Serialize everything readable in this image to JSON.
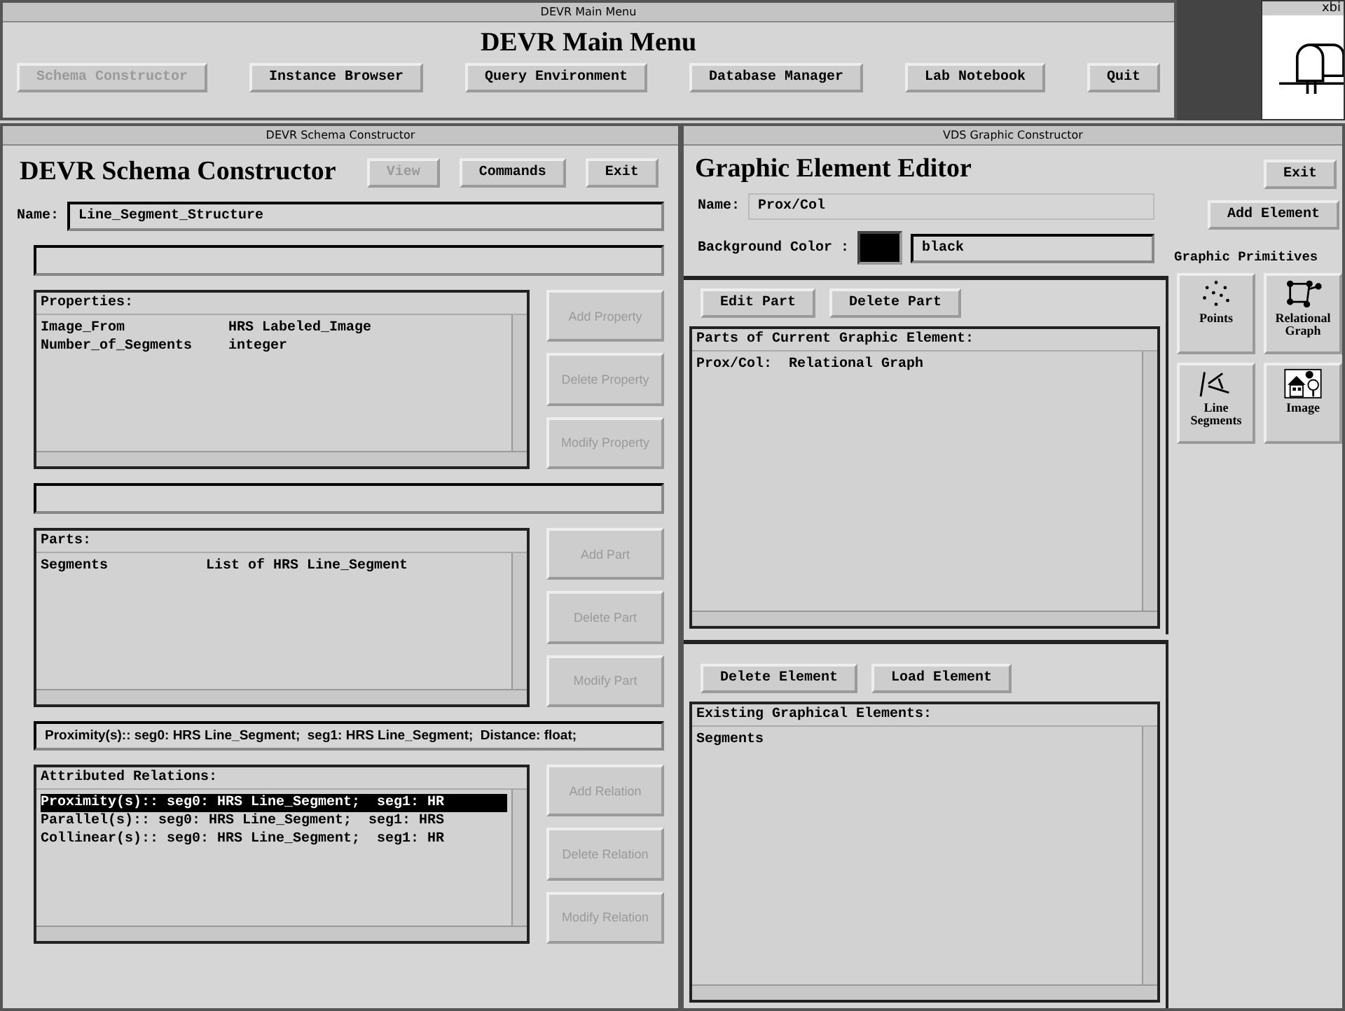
{
  "main_menu": {
    "title": "DEVR Main Menu",
    "heading": "DEVR Main Menu",
    "buttons": [
      {
        "label": "Schema Constructor",
        "disabled": true
      },
      {
        "label": "Instance Browser",
        "disabled": false
      },
      {
        "label": "Query Environment",
        "disabled": false
      },
      {
        "label": "Database Manager",
        "disabled": false
      },
      {
        "label": "Lab Notebook",
        "disabled": false
      },
      {
        "label": "Quit",
        "disabled": false
      }
    ]
  },
  "mailbox": {
    "title": "xbi"
  },
  "schema_constructor": {
    "title": "DEVR Schema Constructor",
    "heading": "DEVR Schema Constructor",
    "buttons": [
      {
        "label": "View",
        "disabled": true
      },
      {
        "label": "Commands",
        "disabled": false
      },
      {
        "label": "Exit",
        "disabled": false
      }
    ],
    "name_label": "Name:",
    "name_value": "Line_Segment_Structure",
    "properties": {
      "heading": "Properties:",
      "rows": [
        [
          "Image_From",
          "HRS Labeled_Image"
        ],
        [
          "Number_of_Segments",
          "integer"
        ]
      ],
      "buttons": [
        {
          "label": "Add Property",
          "disabled": true
        },
        {
          "label": "Delete Property",
          "disabled": true
        },
        {
          "label": "Modify Property",
          "disabled": true
        }
      ]
    },
    "parts": {
      "heading": "Parts:",
      "rows": [
        [
          "Segments",
          "List of HRS Line_Segment"
        ]
      ],
      "buttons": [
        {
          "label": "Add Part",
          "disabled": true
        },
        {
          "label": "Delete Part",
          "disabled": true
        },
        {
          "label": "Modify Part",
          "disabled": true
        }
      ]
    },
    "relation_definition": "Proximity(s):: seg0: HRS Line_Segment;  seg1: HRS Line_Segment;  Distance: float;",
    "relations": {
      "heading": "Attributed Relations:",
      "rows": [
        {
          "text": "Proximity(s):: seg0: HRS Line_Segment;  seg1: HR",
          "selected": true
        },
        {
          "text": "Parallel(s):: seg0: HRS Line_Segment;  seg1: HRS",
          "selected": false
        },
        {
          "text": "Collinear(s):: seg0: HRS Line_Segment;  seg1: HR",
          "selected": false
        }
      ],
      "buttons": [
        {
          "label": "Add Relation",
          "disabled": true
        },
        {
          "label": "Delete Relation",
          "disabled": true
        },
        {
          "label": "Modify Relation",
          "disabled": true
        }
      ]
    }
  },
  "graphic_constructor": {
    "title": "VDS Graphic Constructor",
    "heading": "Graphic Element Editor",
    "exit_button": "Exit",
    "add_button": "Add Element",
    "name_label": "Name:",
    "name_value": "Prox/Col",
    "color_label": "Background Color :",
    "color": "#000000",
    "color_value": "black",
    "part_buttons": [
      "Edit Part",
      "Delete Part"
    ],
    "parts": {
      "heading": "Parts of Current Graphic Element:",
      "rows": [
        "Prox/Col:  Relational Graph"
      ]
    },
    "element_buttons": [
      "Delete Element",
      "Load Element"
    ],
    "elements": {
      "heading": "Existing Graphical Elements:",
      "rows": [
        "Segments"
      ]
    },
    "primitives": {
      "heading": "Graphic Primitives",
      "items": [
        {
          "kind": "points",
          "label": "Points"
        },
        {
          "kind": "graph",
          "label": "Relational Graph"
        },
        {
          "kind": "lines",
          "label": "Line Segments"
        },
        {
          "kind": "image",
          "label": "Image"
        }
      ]
    }
  }
}
